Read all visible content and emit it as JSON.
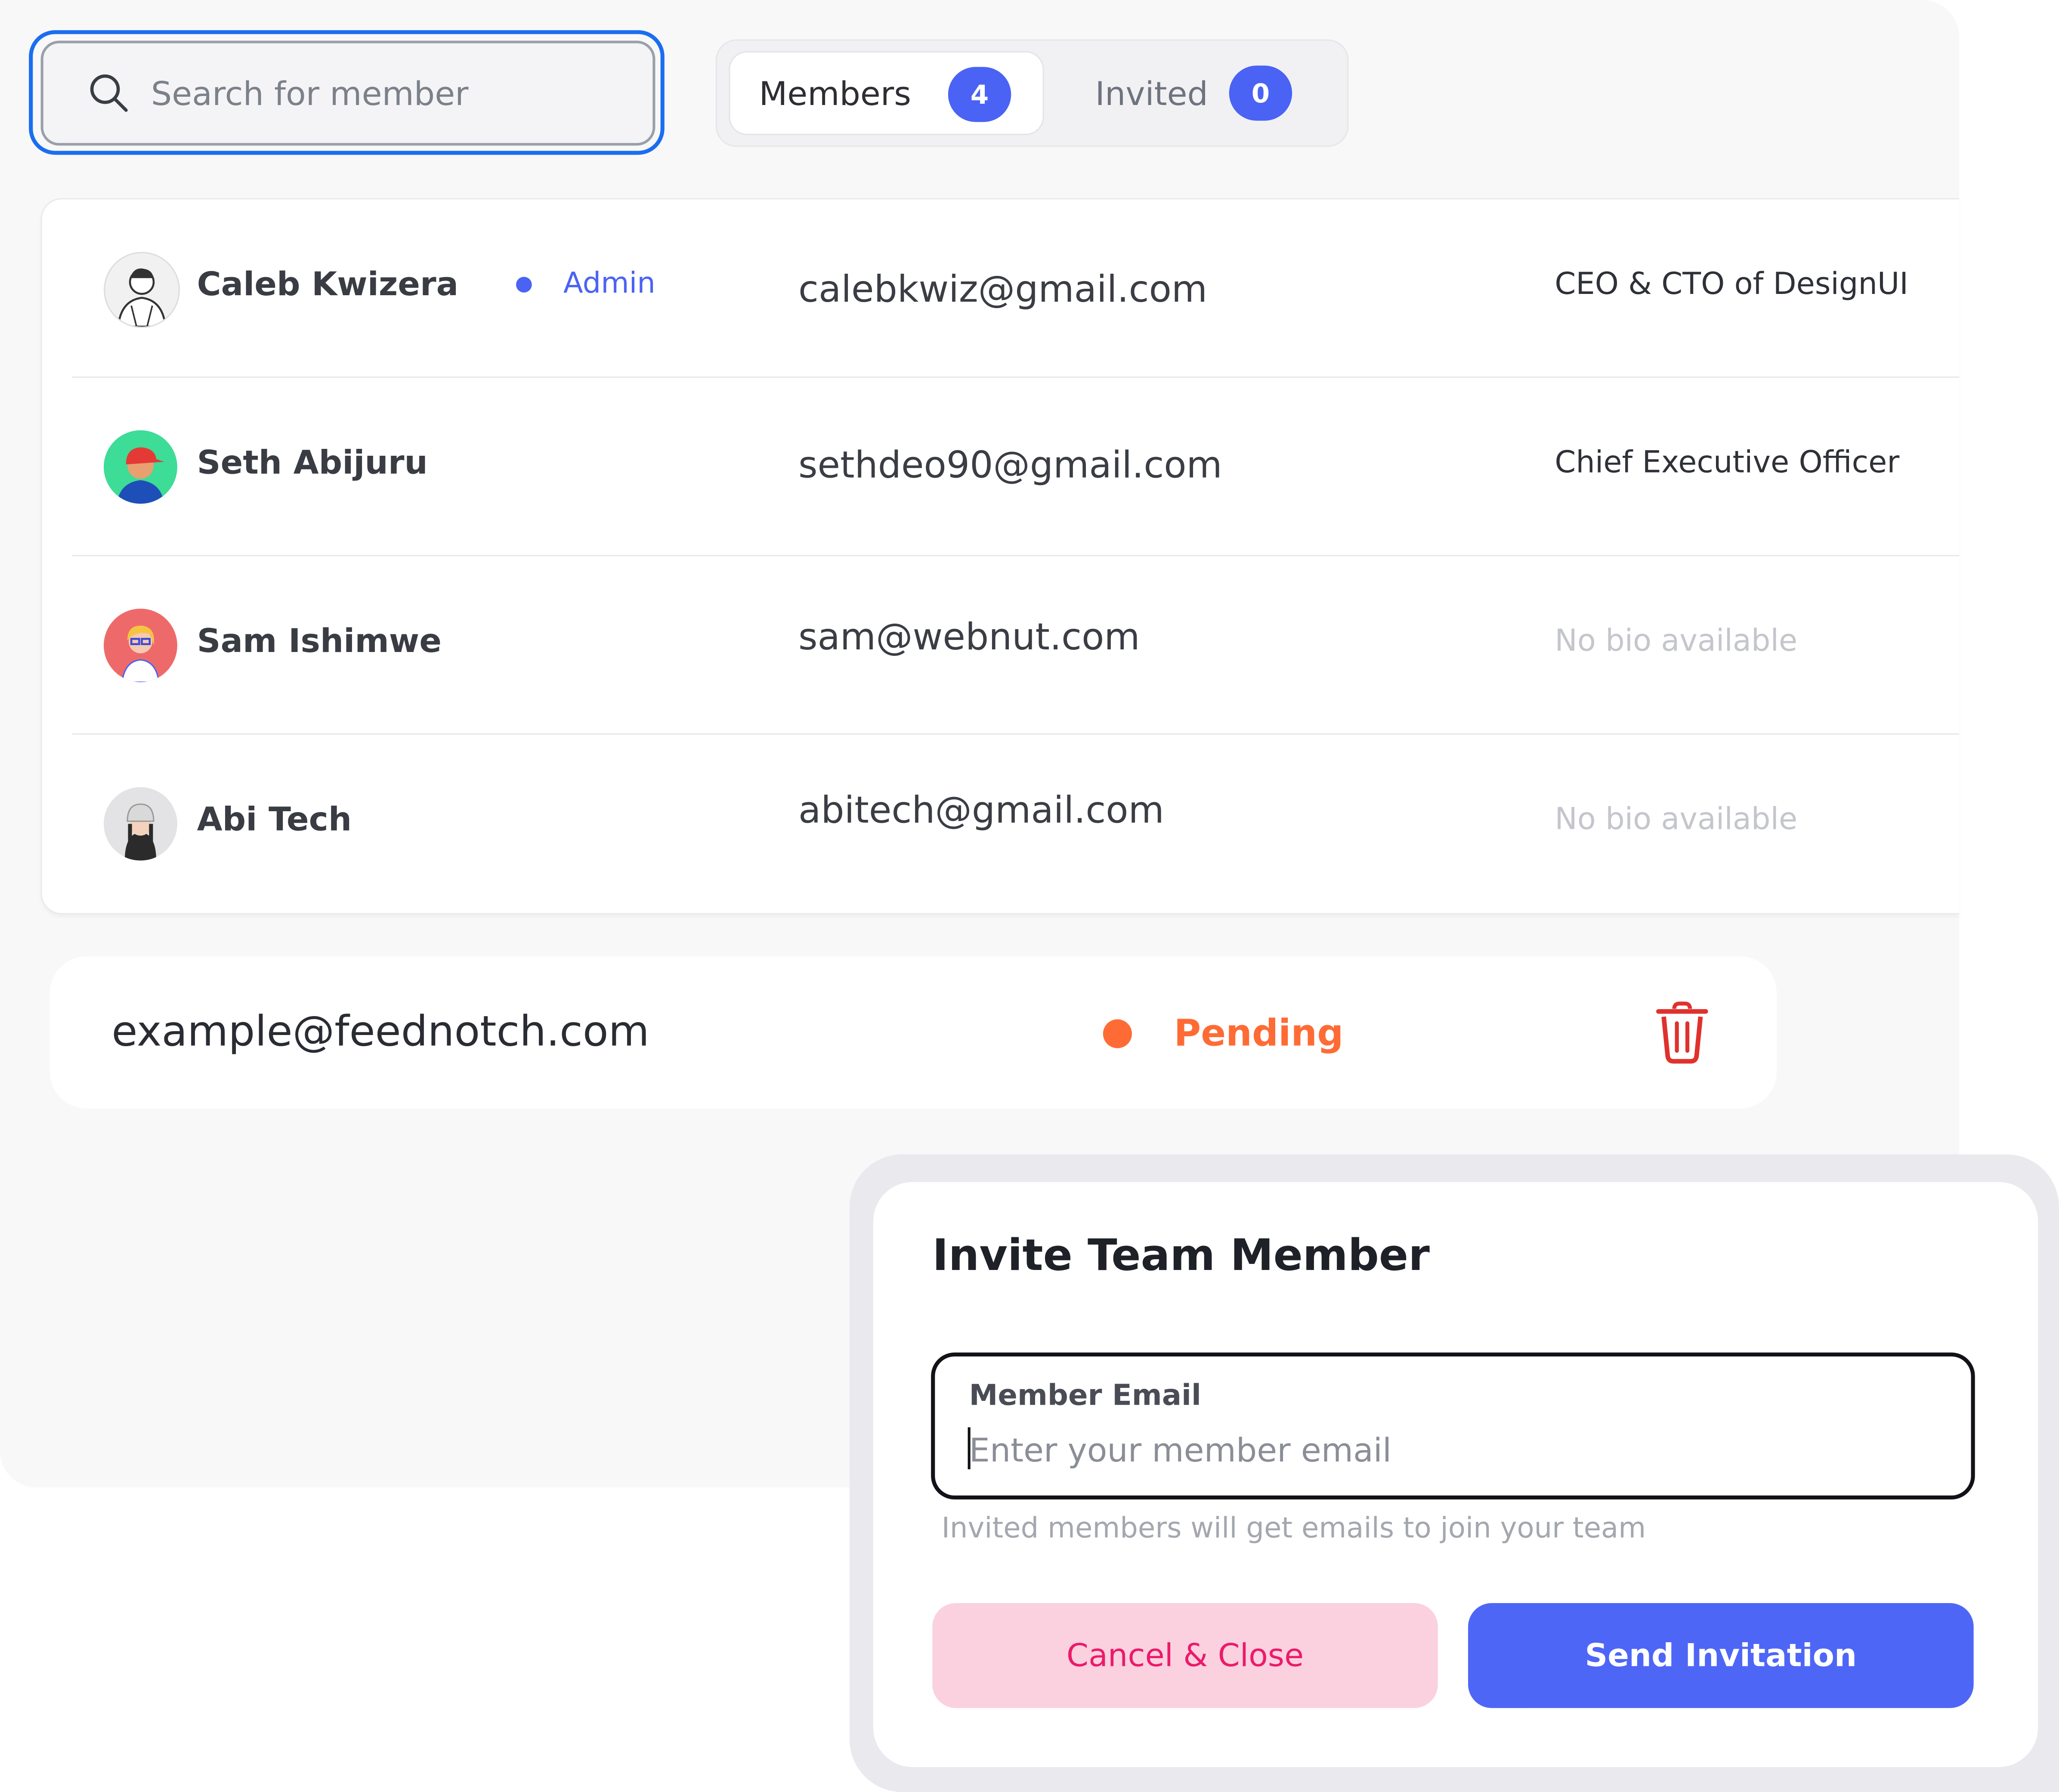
{
  "search": {
    "placeholder": "Search for member"
  },
  "tabs": [
    {
      "label": "Members",
      "count": "4",
      "active": true
    },
    {
      "label": "Invited",
      "count": "0",
      "active": false
    }
  ],
  "members": [
    {
      "name": "Caleb Kwizera",
      "role": "Admin",
      "email": "calebkwiz@gmail.com",
      "bio": "CEO & CTO of DesignUI"
    },
    {
      "name": "Seth Abijuru",
      "email": "sethdeo90@gmail.com",
      "bio": "Chief Executive Officer"
    },
    {
      "name": "Sam Ishimwe",
      "email": "sam@webnut.com",
      "bio": "No bio available"
    },
    {
      "name": "Abi Tech",
      "email": "abitech@gmail.com",
      "bio": "No bio available"
    }
  ],
  "invited": {
    "email": "example@feednotch.com",
    "status": "Pending"
  },
  "modal": {
    "title": "Invite Team Member",
    "field_label": "Member Email",
    "field_placeholder": "Enter your member email",
    "helper": "Invited members will get emails to join your team",
    "cancel_label": "Cancel & Close",
    "send_label": "Send Invitation"
  },
  "colors": {
    "accent": "#4a63f5",
    "pending": "#ff6b35",
    "delete": "#e0312c",
    "cancel_bg": "#fbd1df",
    "cancel_text": "#ec1a6a",
    "focus_ring": "#1a6ef0"
  },
  "icons": {
    "search": "search-icon",
    "trash": "trash-icon",
    "avatars": [
      "sketch-man-avatar",
      "red-cap-avatar",
      "blonde-glasses-avatar",
      "girl-with-cap-avatar"
    ]
  }
}
